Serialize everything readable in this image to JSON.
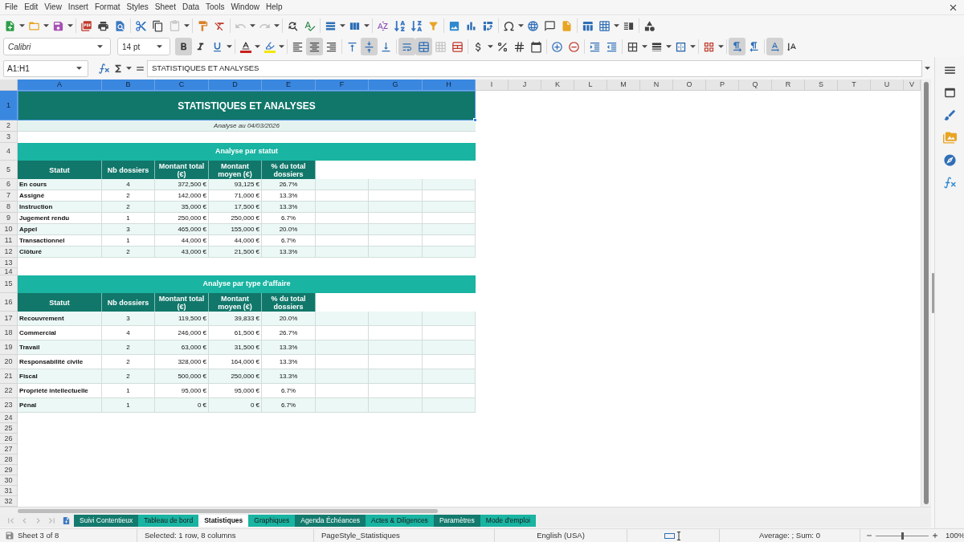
{
  "menu_bar": [
    "File",
    "Edit",
    "View",
    "Insert",
    "Format",
    "Styles",
    "Sheet",
    "Data",
    "Tools",
    "Window",
    "Help"
  ],
  "standard_toolbar": {
    "disabled": {
      "paste": true,
      "undo": true,
      "redo": true
    }
  },
  "formatting_toolbar": {
    "font_name": "Calibri",
    "font_size": "14 pt",
    "pressed": {
      "bold": true,
      "italic": false,
      "underline": false,
      "align_left": false,
      "align_center": true,
      "align_right": false,
      "align_top": false,
      "center_vertically": true,
      "align_bottom": false,
      "wrap_text": true,
      "merge_and_center": true,
      "left_to_right": true,
      "right_to_left": false,
      "text_left_to_right": true,
      "text_top_to_bottom": false
    },
    "disabled": {
      "merge_cells": true
    }
  },
  "formula_bar": {
    "name_box": "A1:H1",
    "content": "STATISTIQUES ET ANALYSES"
  },
  "sheet": {
    "columns": [
      {
        "label": "A",
        "selected": true
      },
      {
        "label": "B",
        "selected": true
      },
      {
        "label": "C",
        "selected": true
      },
      {
        "label": "D",
        "selected": true
      },
      {
        "label": "E",
        "selected": true
      },
      {
        "label": "F",
        "selected": true
      },
      {
        "label": "G",
        "selected": true
      },
      {
        "label": "H",
        "selected": true
      },
      {
        "label": "I",
        "selected": false
      },
      {
        "label": "J",
        "selected": false
      },
      {
        "label": "K",
        "selected": false
      },
      {
        "label": "L",
        "selected": false
      },
      {
        "label": "M",
        "selected": false
      },
      {
        "label": "N",
        "selected": false
      },
      {
        "label": "O",
        "selected": false
      },
      {
        "label": "P",
        "selected": false
      },
      {
        "label": "Q",
        "selected": false
      },
      {
        "label": "R",
        "selected": false
      },
      {
        "label": "S",
        "selected": false
      },
      {
        "label": "T",
        "selected": false
      },
      {
        "label": "U",
        "selected": false
      },
      {
        "label": "V",
        "selected": false
      }
    ],
    "rows": [
      {
        "label": "1",
        "selected": true
      },
      {
        "label": "2",
        "selected": false
      },
      {
        "label": "3",
        "selected": false
      },
      {
        "label": "4",
        "selected": false
      },
      {
        "label": "5",
        "selected": false
      },
      {
        "label": "6",
        "selected": false
      },
      {
        "label": "7",
        "selected": false
      },
      {
        "label": "8",
        "selected": false
      },
      {
        "label": "9",
        "selected": false
      },
      {
        "label": "10",
        "selected": false
      },
      {
        "label": "11",
        "selected": false
      },
      {
        "label": "12",
        "selected": false
      },
      {
        "label": "13",
        "selected": false
      },
      {
        "label": "14",
        "selected": false
      },
      {
        "label": "15",
        "selected": false
      },
      {
        "label": "16",
        "selected": false
      },
      {
        "label": "17",
        "selected": false
      },
      {
        "label": "18",
        "selected": false
      },
      {
        "label": "19",
        "selected": false
      },
      {
        "label": "20",
        "selected": false
      },
      {
        "label": "21",
        "selected": false
      },
      {
        "label": "22",
        "selected": false
      },
      {
        "label": "23",
        "selected": false
      },
      {
        "label": "24",
        "selected": false
      },
      {
        "label": "25",
        "selected": false
      },
      {
        "label": "26",
        "selected": false
      },
      {
        "label": "27",
        "selected": false
      },
      {
        "label": "28",
        "selected": false
      },
      {
        "label": "29",
        "selected": false
      },
      {
        "label": "30",
        "selected": false
      },
      {
        "label": "31",
        "selected": false
      },
      {
        "label": "32",
        "selected": false
      }
    ],
    "title": "STATISTIQUES ET ANALYSES",
    "subtitle": "Analyse au 04/03/2026",
    "sections": [
      {
        "heading": "Analyse par statut",
        "columns": [
          "Statut",
          "Nb dossiers",
          "Montant total (€)",
          "Montant moyen (€)",
          "% du total dossiers"
        ],
        "rows": [
          [
            "En cours",
            "4",
            "372,500 €",
            "93,125 €",
            "26.7%"
          ],
          [
            "Assigné",
            "2",
            "142,000 €",
            "71,000 €",
            "13.3%"
          ],
          [
            "Instruction",
            "2",
            "35,000 €",
            "17,500 €",
            "13.3%"
          ],
          [
            "Jugement rendu",
            "1",
            "250,000 €",
            "250,000 €",
            "6.7%"
          ],
          [
            "Appel",
            "3",
            "465,000 €",
            "155,000 €",
            "20.0%"
          ],
          [
            "Transactionnel",
            "1",
            "44,000 €",
            "44,000 €",
            "6.7%"
          ],
          [
            "Clôturé",
            "2",
            "43,000 €",
            "21,500 €",
            "13.3%"
          ]
        ]
      },
      {
        "heading": "Analyse par type d'affaire",
        "columns": [
          "Statut",
          "Nb dossiers",
          "Montant total (€)",
          "Montant moyen (€)",
          "% du total dossiers"
        ],
        "rows": [
          [
            "Recouvrement",
            "3",
            "119,500 €",
            "39,833 €",
            "20.0%"
          ],
          [
            "Commercial",
            "4",
            "246,000 €",
            "61,500 €",
            "26.7%"
          ],
          [
            "Travail",
            "2",
            "63,000 €",
            "31,500 €",
            "13.3%"
          ],
          [
            "Responsabilité civile",
            "2",
            "328,000 €",
            "164,000 €",
            "13.3%"
          ],
          [
            "Fiscal",
            "2",
            "500,000 €",
            "250,000 €",
            "13.3%"
          ],
          [
            "Propriété intellectuelle",
            "1",
            "95,000 €",
            "95,000 €",
            "6.7%"
          ],
          [
            "Pénal",
            "1",
            "0 €",
            "0 €",
            "6.7%"
          ]
        ]
      }
    ]
  },
  "sheet_tabs": [
    {
      "label": "Suivi Contentieux",
      "selected": false,
      "color": "#137a6e"
    },
    {
      "label": "Tableau de bord",
      "selected": false,
      "color": "#19b4a2"
    },
    {
      "label": "Statistiques",
      "selected": true
    },
    {
      "label": "Graphiques",
      "selected": false,
      "color": "#19b4a2"
    },
    {
      "label": "Agenda Échéances",
      "selected": false,
      "color": "#137a6e"
    },
    {
      "label": "Actes & Diligences",
      "selected": false,
      "color": "#19b4a2"
    },
    {
      "label": "Paramètres",
      "selected": false,
      "color": "#137a6e"
    },
    {
      "label": "Mode d'emploi",
      "selected": false,
      "color": "#19b4a2"
    }
  ],
  "status_bar": {
    "sheet": "Sheet 3 of 8",
    "selection": "Selected: 1 row, 8 columns",
    "page_style": "PageStyle_Statistiques",
    "language": "English (USA)",
    "summary": "Average: ; Sum: 0",
    "zoom": {
      "level": 0.5,
      "reading": "100%"
    }
  }
}
